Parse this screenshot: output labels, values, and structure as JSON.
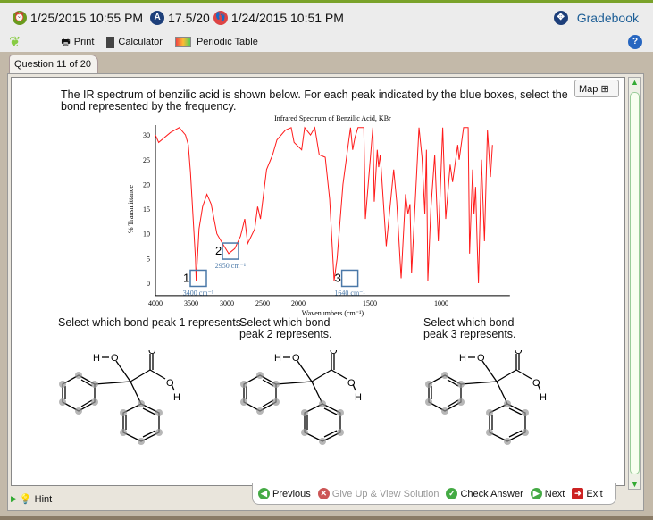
{
  "header": {
    "due_date": "1/25/2015 10:55 PM",
    "score": "17.5/20",
    "last_attempt": "1/24/2015 10:51 PM",
    "gradebook": "Gradebook"
  },
  "toolbar": {
    "print": "Print",
    "calculator": "Calculator",
    "periodic_table": "Periodic Table"
  },
  "tab": "Question 11 of 20",
  "map_label": "Map",
  "question": "The IR spectrum of benzilic acid is shown below. For each peak indicated by the blue boxes, select the bond represented by the frequency.",
  "selects": [
    "Select which bond peak 1 represents.",
    "Select which bond peak 2 represents.",
    "Select which bond peak 3 represents."
  ],
  "molecule_labels": {
    "h1": "H",
    "o1": "O",
    "o2": "O",
    "o3": "O",
    "h2": "H"
  },
  "hint": "Hint",
  "nav": {
    "previous": "Previous",
    "give_up": "Give Up & View Solution",
    "check": "Check Answer",
    "next": "Next",
    "exit": "Exit"
  },
  "chart_data": {
    "type": "line",
    "title": "Infrared Spectrum of Benzilic Acid, KBr",
    "xlabel": "Wavenumbers (cm⁻¹)",
    "ylabel": "% Transmittance",
    "xticks": [
      4000,
      3500,
      3000,
      2500,
      2000,
      1500,
      1000
    ],
    "yticks": [
      0,
      5,
      10,
      15,
      20,
      25,
      30
    ],
    "ylim": [
      -2.5,
      32
    ],
    "xlim": [
      4000,
      520
    ],
    "peaks": [
      {
        "label": "1",
        "freq": "3400 cm⁻¹",
        "x": 3400,
        "y": 1
      },
      {
        "label": "2",
        "freq": "2950 cm⁻¹",
        "x": 2950,
        "y": 6.5
      },
      {
        "label": "3",
        "freq": "1640 cm⁻¹",
        "x": 1640,
        "y": 1
      }
    ],
    "color": "#ff1a1a",
    "box_color": "#4a78a8",
    "points": [
      [
        4000,
        30
      ],
      [
        3955,
        28.5
      ],
      [
        3790,
        30.5
      ],
      [
        3667,
        31.5
      ],
      [
        3580,
        30
      ],
      [
        3540,
        28
      ],
      [
        3510,
        22.5
      ],
      [
        3440,
        5
      ],
      [
        3430,
        0.5
      ],
      [
        3390,
        11
      ],
      [
        3340,
        15.5
      ],
      [
        3280,
        18
      ],
      [
        3220,
        16
      ],
      [
        3140,
        10
      ],
      [
        3060,
        8
      ],
      [
        2975,
        6
      ],
      [
        2890,
        7
      ],
      [
        2810,
        9.5
      ],
      [
        2750,
        13
      ],
      [
        2710,
        8
      ],
      [
        2610,
        11
      ],
      [
        2570,
        15.5
      ],
      [
        2530,
        13
      ],
      [
        2445,
        23
      ],
      [
        2360,
        26
      ],
      [
        2300,
        29
      ],
      [
        2180,
        31
      ],
      [
        2100,
        31.5
      ],
      [
        2060,
        28.5
      ],
      [
        1977,
        27
      ],
      [
        1956,
        31.5
      ],
      [
        1915,
        30
      ],
      [
        1885,
        31.5
      ],
      [
        1854,
        26
      ],
      [
        1812,
        25.5
      ],
      [
        1781,
        17
      ],
      [
        1750,
        0.5
      ],
      [
        1729,
        5
      ],
      [
        1688,
        20
      ],
      [
        1656,
        27
      ],
      [
        1635,
        31.5
      ],
      [
        1620,
        27
      ],
      [
        1604,
        29.5
      ],
      [
        1583,
        31.5
      ],
      [
        1542,
        31.5
      ],
      [
        1531,
        13
      ],
      [
        1479,
        31.5
      ],
      [
        1469,
        16.5
      ],
      [
        1448,
        27
      ],
      [
        1438,
        23.5
      ],
      [
        1427,
        26
      ],
      [
        1385,
        7.5
      ],
      [
        1333,
        23
      ],
      [
        1312,
        16.5
      ],
      [
        1281,
        1
      ],
      [
        1250,
        18
      ],
      [
        1233,
        14
      ],
      [
        1219,
        16
      ],
      [
        1208,
        2
      ],
      [
        1156,
        31.5
      ],
      [
        1135,
        25.5
      ],
      [
        1115,
        14
      ],
      [
        1104,
        27
      ],
      [
        1094,
        0.5
      ],
      [
        1073,
        15
      ],
      [
        1046,
        26
      ],
      [
        1021,
        8.5
      ],
      [
        990,
        31.5
      ],
      [
        969,
        13
      ],
      [
        938,
        24
      ],
      [
        921,
        20.5
      ],
      [
        885,
        28
      ],
      [
        875,
        25
      ],
      [
        844,
        31.5
      ],
      [
        812,
        31.5
      ],
      [
        802,
        6
      ],
      [
        781,
        23
      ],
      [
        771,
        14
      ],
      [
        760,
        19.5
      ],
      [
        750,
        9
      ],
      [
        740,
        0
      ],
      [
        719,
        25
      ],
      [
        698,
        8.5
      ],
      [
        677,
        31
      ],
      [
        656,
        21.5
      ],
      [
        642,
        28
      ]
    ]
  }
}
